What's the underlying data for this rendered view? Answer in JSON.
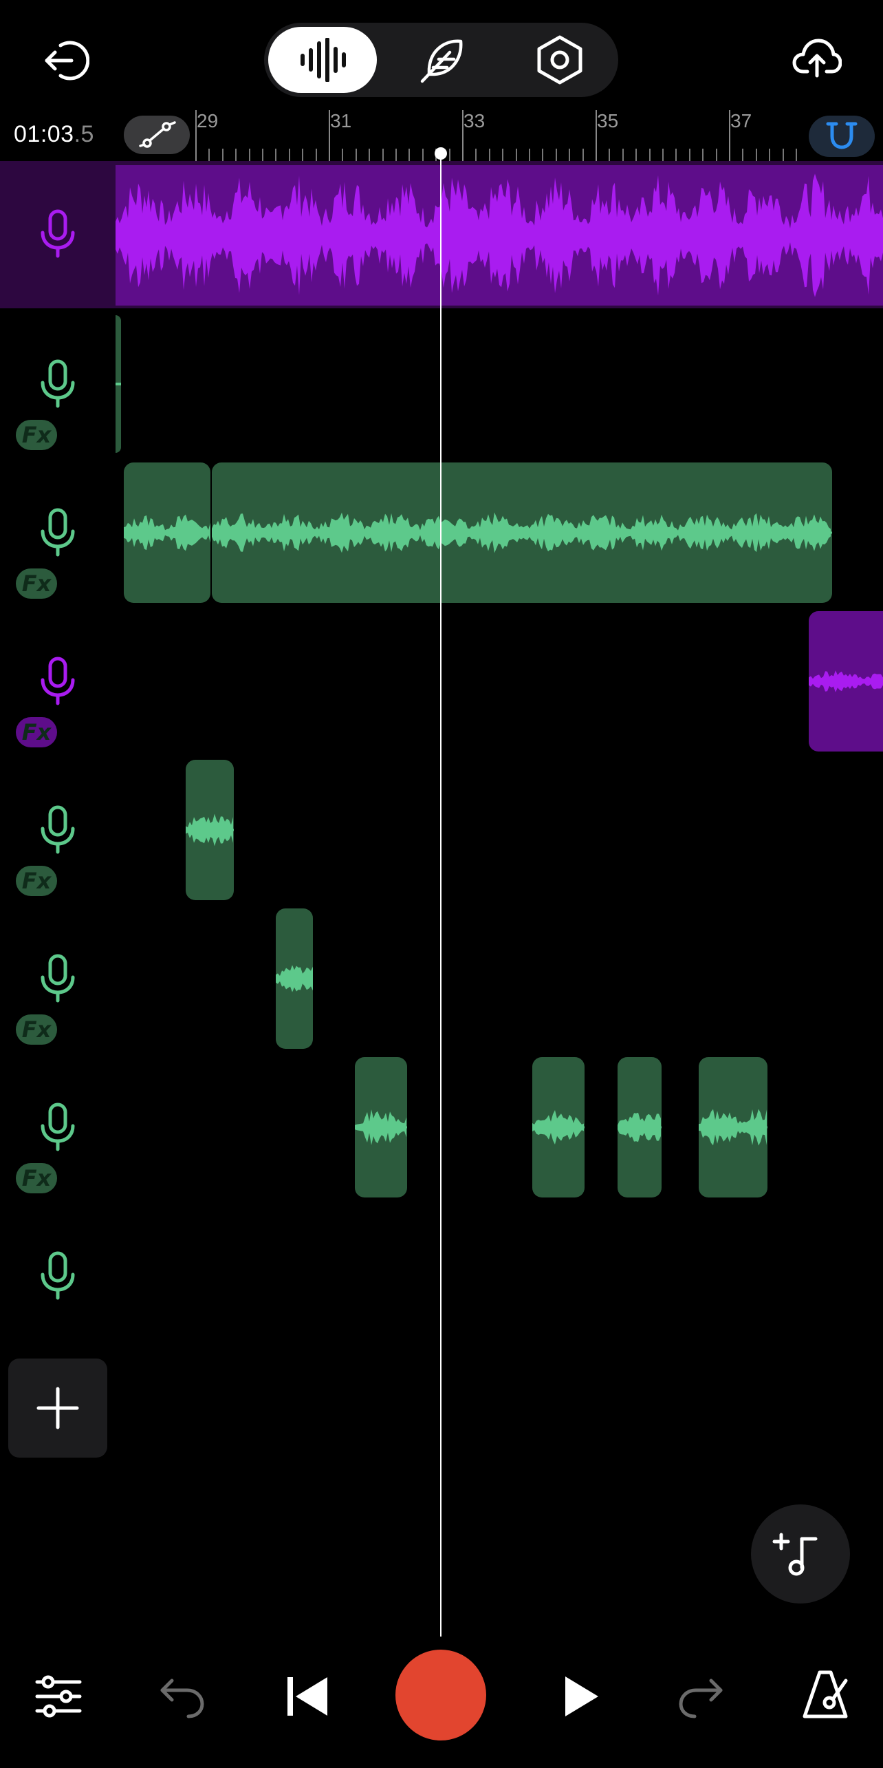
{
  "header": {
    "exit_icon": "exit-icon",
    "modes": [
      {
        "name": "waveform-mode",
        "icon": "waveform-icon",
        "active": true
      },
      {
        "name": "feather-mode",
        "icon": "feather-icon",
        "active": false
      },
      {
        "name": "settings-mode",
        "icon": "hexagon-settings-icon",
        "active": false
      }
    ],
    "cloud_icon": "cloud-upload-icon"
  },
  "timeline": {
    "time_main": "01:03",
    "time_fraction": ".5",
    "ruler_labels": [
      "29",
      "31",
      "33",
      "35",
      "37"
    ]
  },
  "tracks": [
    {
      "id": 1,
      "color": "purple",
      "selected": true,
      "fx": false
    },
    {
      "id": 2,
      "color": "green",
      "selected": false,
      "fx": true
    },
    {
      "id": 3,
      "color": "green",
      "selected": false,
      "fx": true
    },
    {
      "id": 4,
      "color": "purple",
      "selected": false,
      "fx": true
    },
    {
      "id": 5,
      "color": "green",
      "selected": false,
      "fx": true
    },
    {
      "id": 6,
      "color": "green",
      "selected": false,
      "fx": true
    },
    {
      "id": 7,
      "color": "green",
      "selected": false,
      "fx": true
    },
    {
      "id": 8,
      "color": "green",
      "selected": false,
      "fx": false
    }
  ],
  "fx_label": "Fx",
  "colors": {
    "purple": "#a91cf0",
    "purple_bg": "#5e0d8a",
    "purple_dark_bg": "#2d0740",
    "green": "#5dc98b",
    "green_bg": "#2c5b3d",
    "record": "#e2452f",
    "magnet": "#2c8cf0"
  },
  "bottom_bar": {
    "icons": [
      "mixer-sliders-icon",
      "undo-icon",
      "skip-to-start-icon",
      "record-button",
      "play-icon",
      "redo-icon",
      "metronome-icon"
    ]
  }
}
